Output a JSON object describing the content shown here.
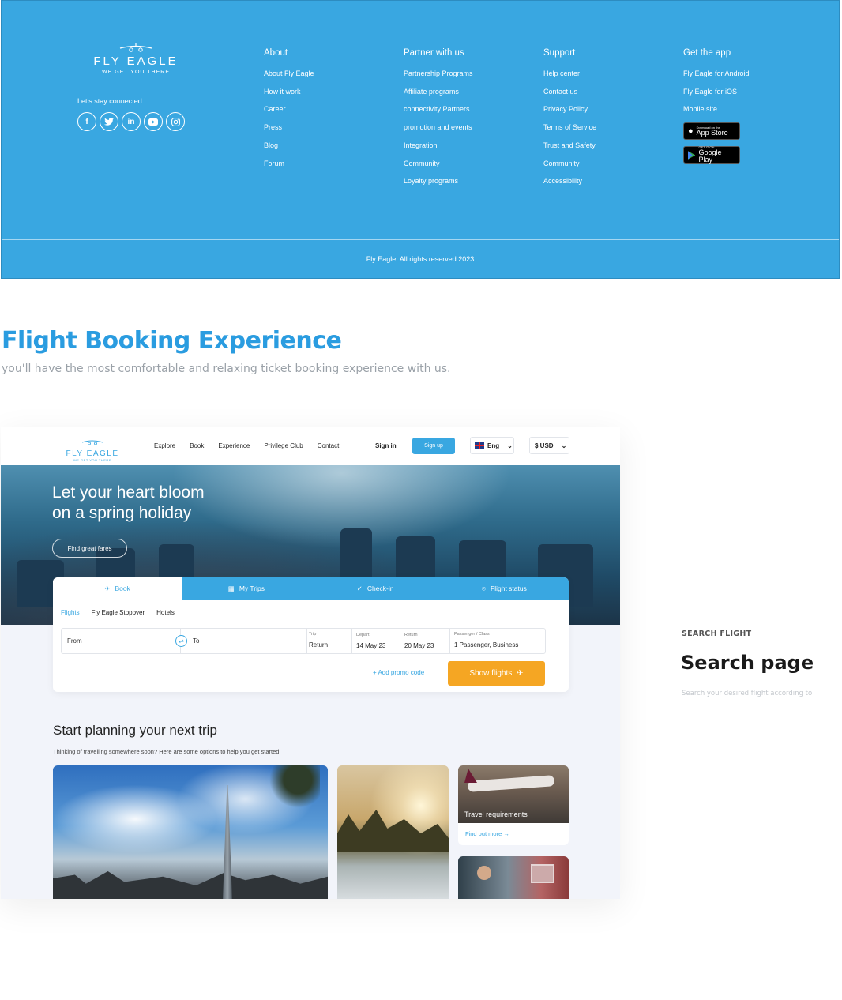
{
  "footer": {
    "brand": "FLY EAGLE",
    "tagline": "WE GET YOU THERE",
    "stay_connected": "Let's stay connected",
    "social": [
      {
        "icon": "facebook-icon",
        "glyph": "f"
      },
      {
        "icon": "twitter-icon",
        "glyph": "t"
      },
      {
        "icon": "linkedin-icon",
        "glyph": "in"
      },
      {
        "icon": "youtube-icon",
        "glyph": "▶"
      },
      {
        "icon": "instagram-icon",
        "glyph": "◎"
      }
    ],
    "columns": [
      {
        "title": "About",
        "links": [
          "About Fly Eagle",
          "How it work",
          "Career",
          "Press",
          "Blog",
          "Forum"
        ]
      },
      {
        "title": "Partner with us",
        "links": [
          "Partnership Programs",
          "Affiliate programs",
          "connectivity Partners",
          "promotion and events",
          "Integration",
          "Community",
          "Loyalty programs"
        ]
      },
      {
        "title": "Support",
        "links": [
          "Help center",
          "Contact us",
          "Privacy Policy",
          "Terms of Service",
          "Trust and Safety",
          "Community",
          "Accessibility"
        ]
      },
      {
        "title": "Get the app",
        "links": [
          "Fly Eagle for Android",
          "Fly Eagle for iOS",
          "Mobile site"
        ]
      }
    ],
    "app_store": {
      "small": "Download on the",
      "big": "App Store"
    },
    "google_play": {
      "small": "GET IT ON",
      "big": "Google Play"
    },
    "copyright": "Fly Eagle. All rights reserved 2023",
    "bg_color": "#39a7e1"
  },
  "section": {
    "title": "Flight Booking Experience",
    "subtitle": "you'll have the most comfortable and relaxing ticket booking experience with us.",
    "accent": "#2a9ce0"
  },
  "mockup": {
    "brand": "FLY EAGLE",
    "tagline": "WE GET YOU THERE",
    "nav": [
      "Explore",
      "Book",
      "Experience",
      "Privilege Club",
      "Contact"
    ],
    "sign_in": "Sign in",
    "sign_up": "Sign up",
    "language": "Eng",
    "currency": "$ USD",
    "hero_title_1": "Let your heart bloom",
    "hero_title_2": "on a spring holiday",
    "hero_button": "Find great fares",
    "tabs": [
      {
        "label": "Book",
        "icon": "plane-icon",
        "glyph": "✈"
      },
      {
        "label": "My Trips",
        "icon": "calendar-icon",
        "glyph": "▦"
      },
      {
        "label": "Check-in",
        "icon": "check-circle-icon",
        "glyph": "✓"
      },
      {
        "label": "Flight status",
        "icon": "location-pin-icon",
        "glyph": "⌾"
      }
    ],
    "subtabs": [
      "Flights",
      "Fly Eagle Stopover",
      "Hotels"
    ],
    "from_placeholder": "From",
    "to_placeholder": "To",
    "trip_label": "Trip",
    "trip_value": "Return",
    "depart_label": "Depart",
    "depart_value": "14 May 23",
    "return_label": "Return",
    "return_value": "20 May 23",
    "passenger_label": "Passenger / Class",
    "passenger_value": "1 Passenger, Business",
    "promo": "+  Add promo code",
    "show_flights": "Show flights",
    "plan_title": "Start planning your next trip",
    "plan_sub": "Thinking of travelling somewhere soon? Here are some options to help you get started.",
    "travel_caption": "Travel requirements",
    "find_out_more": "Find out more →",
    "accent": "#39a7e1",
    "cta_color": "#f5a623"
  },
  "side": {
    "eyebrow": "SEARCH FLIGHT",
    "title": "Search page",
    "subtitle": "Search your desired flight according to"
  }
}
